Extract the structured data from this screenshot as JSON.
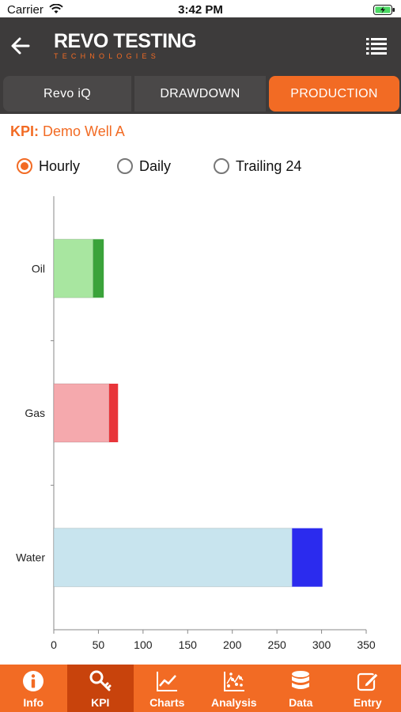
{
  "status_bar": {
    "carrier": "Carrier",
    "time": "3:42 PM"
  },
  "header": {
    "logo_main": "REVO TESTING",
    "logo_sub": "TECHNOLOGIES"
  },
  "segments": [
    {
      "label": "Revo iQ",
      "selected": false
    },
    {
      "label": "DRAWDOWN",
      "selected": false
    },
    {
      "label": "PRODUCTION",
      "selected": true
    }
  ],
  "kpi": {
    "prefix": "KPI:",
    "well": "Demo Well A"
  },
  "radios": [
    {
      "label": "Hourly",
      "selected": true
    },
    {
      "label": "Daily",
      "selected": false
    },
    {
      "label": "Trailing 24",
      "selected": false
    }
  ],
  "chart_data": {
    "type": "bar",
    "orientation": "horizontal",
    "stacked": true,
    "categories": [
      "Oil",
      "Gas",
      "Water"
    ],
    "series": [
      {
        "values": [
          44,
          62,
          267
        ],
        "colors": [
          "#a8e6a0",
          "#f5a9ad",
          "#c8e4ee"
        ]
      },
      {
        "values": [
          12,
          10,
          34
        ],
        "colors": [
          "#3aa33a",
          "#e8353a",
          "#2b2bee"
        ]
      }
    ],
    "xlim": [
      0,
      350
    ],
    "xticks": [
      0,
      50,
      100,
      150,
      200,
      250,
      300,
      350
    ],
    "grid": false
  },
  "tabbar": [
    {
      "label": "Info",
      "icon": "info-icon",
      "active": false
    },
    {
      "label": "KPI",
      "icon": "key-icon",
      "active": true
    },
    {
      "label": "Charts",
      "icon": "line-chart-icon",
      "active": false
    },
    {
      "label": "Analysis",
      "icon": "scatter-chart-icon",
      "active": false
    },
    {
      "label": "Data",
      "icon": "database-icon",
      "active": false
    },
    {
      "label": "Entry",
      "icon": "edit-icon",
      "active": false
    }
  ]
}
